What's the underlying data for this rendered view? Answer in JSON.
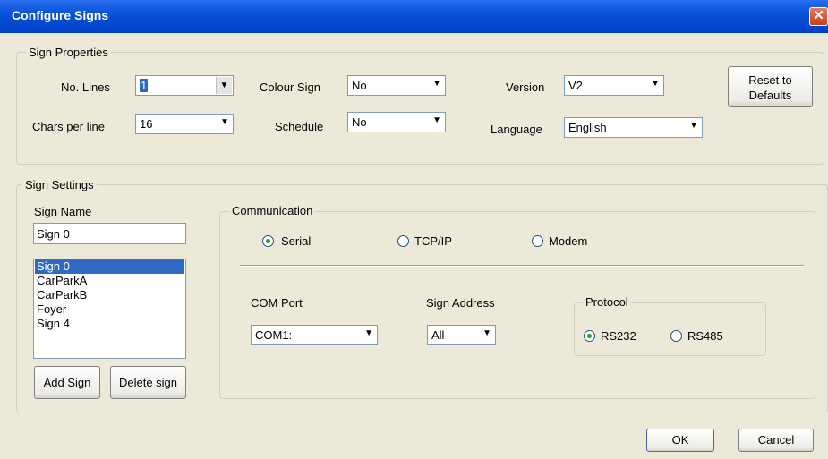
{
  "window": {
    "title": "Configure Signs",
    "close_glyph": "✕"
  },
  "sign_properties": {
    "legend": "Sign Properties",
    "no_lines": {
      "label": "No. Lines",
      "value": "1"
    },
    "chars_per_line": {
      "label": "Chars per line",
      "value": "16"
    },
    "colour_sign": {
      "label": "Colour Sign",
      "value": "No"
    },
    "schedule": {
      "label": "Schedule",
      "value": "No"
    },
    "version": {
      "label": "Version",
      "value": "V2"
    },
    "language": {
      "label": "Language",
      "value": "English"
    },
    "reset_button": {
      "line1": "Reset to",
      "line2": "Defaults"
    }
  },
  "sign_settings": {
    "legend": "Sign Settings",
    "sign_name_label": "Sign Name",
    "sign_name_value": "Sign 0",
    "signs": [
      "Sign 0",
      "CarParkA",
      "CarParkB",
      "Foyer",
      "Sign 4"
    ],
    "selected_index": 0,
    "add_sign_label": "Add Sign",
    "delete_sign_label": "Delete sign"
  },
  "communication": {
    "legend": "Communication",
    "options": [
      "Serial",
      "TCP/IP",
      "Modem"
    ],
    "selected": "Serial",
    "com_port": {
      "label": "COM Port",
      "value": "COM1:"
    },
    "sign_address": {
      "label": "Sign Address",
      "value": "All"
    },
    "protocol": {
      "legend": "Protocol",
      "options": [
        "RS232",
        "RS485"
      ],
      "selected": "RS232"
    }
  },
  "footer": {
    "ok_label": "OK",
    "cancel_label": "Cancel"
  },
  "colors": {
    "titlebar": "#0a52d8",
    "dialog_bg": "#ece9d8",
    "selection": "#316ac5"
  },
  "icons": {
    "dropdown": "chevron-down-icon",
    "close": "close-icon"
  }
}
